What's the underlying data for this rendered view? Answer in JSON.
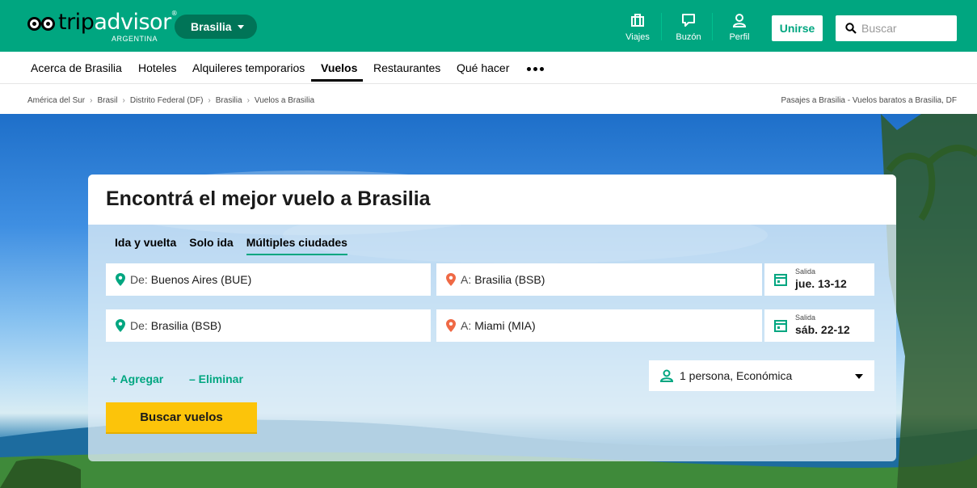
{
  "header": {
    "logo_trip": "trip",
    "logo_advisor": "advisor",
    "logo_country": "ARGENTINA",
    "geo": "Brasilia",
    "trips_label": "Viajes",
    "inbox_label": "Buzón",
    "profile_label": "Perfil",
    "join_label": "Unirse",
    "search_placeholder": "Buscar",
    "brand_color": "#00a680"
  },
  "nav": {
    "items": [
      "Acerca de Brasilia",
      "Hoteles",
      "Alquileres temporarios",
      "Vuelos",
      "Restaurantes",
      "Qué hacer"
    ],
    "active": "Vuelos"
  },
  "breadcrumb": {
    "items": [
      "América del Sur",
      "Brasil",
      "Distrito Federal (DF)",
      "Brasilia",
      "Vuelos a Brasilia"
    ],
    "right": "Pasajes a Brasilia - Vuelos baratos a Brasilia, DF"
  },
  "search": {
    "title": "Encontrá el mejor vuelo a Brasilia",
    "tabs": [
      "Ida y vuelta",
      "Solo ida",
      "Múltiples ciudades"
    ],
    "active_tab": "Múltiples ciudades",
    "legs": [
      {
        "from_prefix": "De:",
        "from": "Buenos Aires (BUE)",
        "to_prefix": "A:",
        "to": "Brasilia (BSB)",
        "date_label": "Salida",
        "date": "jue. 13-12"
      },
      {
        "from_prefix": "De:",
        "from": "Brasilia (BSB)",
        "to_prefix": "A:",
        "to": "Miami (MIA)",
        "date_label": "Salida",
        "date": "sáb. 22-12"
      }
    ],
    "add_label": "+ Agregar",
    "remove_label": "– Eliminar",
    "passengers": "1 persona, Económica",
    "submit_label": "Buscar vuelos",
    "cta_color": "#fcc40a"
  }
}
